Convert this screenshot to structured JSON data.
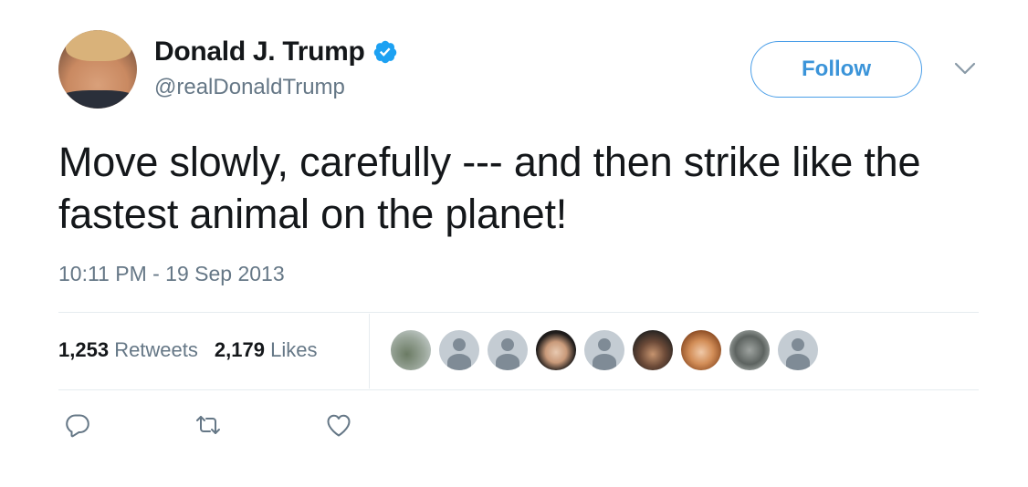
{
  "author": {
    "display_name": "Donald J. Trump",
    "handle": "@realDonaldTrump",
    "verified": true,
    "avatar_icon": "profile-photo"
  },
  "follow_button": {
    "label": "Follow"
  },
  "tweet": {
    "text": "Move slowly, carefully --- and then strike like the fastest animal on the planet!",
    "timestamp": "10:11 PM - 19 Sep 2013"
  },
  "stats": {
    "retweets_count": "1,253",
    "retweets_label": "Retweets",
    "likes_count": "2,179",
    "likes_label": "Likes"
  },
  "likers": [
    {
      "type": "photo",
      "style": "photo1"
    },
    {
      "type": "default",
      "style": "default"
    },
    {
      "type": "default",
      "style": "default"
    },
    {
      "type": "photo",
      "style": "photo2"
    },
    {
      "type": "default",
      "style": "default"
    },
    {
      "type": "photo",
      "style": "photo3"
    },
    {
      "type": "photo",
      "style": "photo4"
    },
    {
      "type": "photo",
      "style": "photo5"
    },
    {
      "type": "default",
      "style": "default"
    }
  ],
  "actions": [
    {
      "icon": "reply-icon"
    },
    {
      "icon": "retweet-icon"
    },
    {
      "icon": "like-icon"
    }
  ],
  "colors": {
    "accent": "#1da1f2",
    "text": "#14171a",
    "secondary_text": "#657786",
    "divider": "#e6ecf0"
  }
}
